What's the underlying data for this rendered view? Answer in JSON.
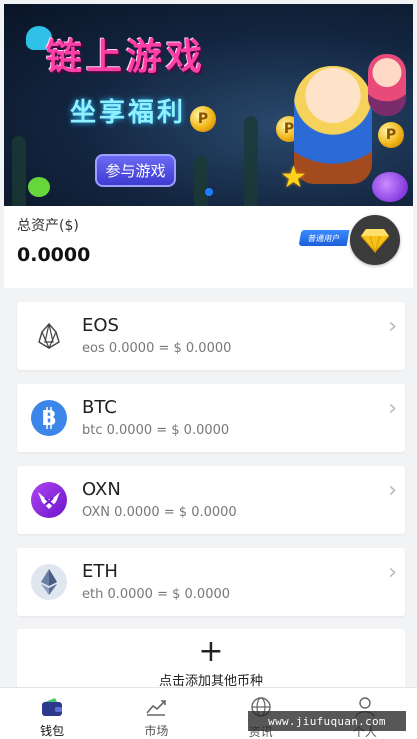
{
  "banner": {
    "title": "链上游戏",
    "slogan": "坐享福利",
    "play_button": "参与游戏",
    "coin_letter": "P",
    "active_slide": 1
  },
  "assets": {
    "label": "总资产($)",
    "value": "0.0000",
    "user_badge": "普通用户"
  },
  "coins": [
    {
      "name": "EOS",
      "desc": "eos 0.0000 = $ 0.0000",
      "icon": "eos-icon",
      "color": "#ffffff"
    },
    {
      "name": "BTC",
      "desc": "btc 0.0000 = $ 0.0000",
      "icon": "bitcoin-icon",
      "color": "#3b86e8"
    },
    {
      "name": "OXN",
      "desc": "OXN 0.0000 = $ 0.0000",
      "icon": "oxn-icon",
      "color": "#8a2be2"
    },
    {
      "name": "ETH",
      "desc": "eth 0.0000 = $ 0.0000",
      "icon": "ethereum-icon",
      "color": "#dfe6ee"
    }
  ],
  "add_coin": {
    "plus": "+",
    "label": "点击添加其他币种"
  },
  "tabs": [
    {
      "label": "钱包",
      "icon": "wallet-icon",
      "active": true
    },
    {
      "label": "市场",
      "icon": "chart-icon",
      "active": false
    },
    {
      "label": "资讯",
      "icon": "globe-icon",
      "active": false
    },
    {
      "label": "个人",
      "icon": "user-icon",
      "active": false
    }
  ],
  "watermark": "www.jiufuquan.com",
  "colors": {
    "accent": "#1e7cff",
    "background": "#f2f3f5",
    "badge": "#2a73f0"
  }
}
